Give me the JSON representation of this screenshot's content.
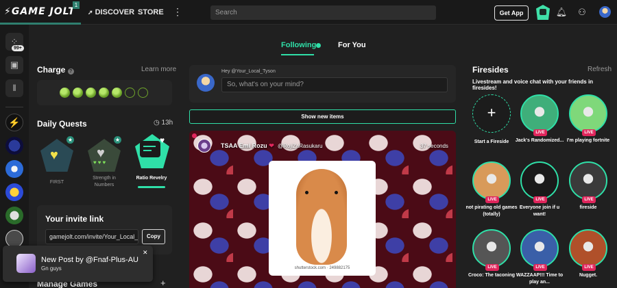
{
  "topbar": {
    "logo": "GAME JOLT",
    "logo_badge": "1",
    "nav_discover": "DISCOVER",
    "nav_store": "STORE",
    "more": "⋮",
    "search_placeholder": "Search",
    "get_app": "Get App"
  },
  "rail": {
    "badge": "99+"
  },
  "charge": {
    "title": "Charge",
    "learn_more": "Learn more",
    "orbs_total": 7,
    "orbs_filled": 5
  },
  "daily_quests": {
    "title": "Daily Quests",
    "timer": "13h",
    "quests": [
      {
        "label": "FIRST"
      },
      {
        "label": "Strength in Numbers"
      },
      {
        "label": "Ratio Revelry"
      }
    ]
  },
  "invite": {
    "title": "Your invite link",
    "link": "gamejolt.com/invite/Your_Local_Tyson",
    "copy": "Copy"
  },
  "toast": {
    "title": "New Post by @Fnaf-Plus-AU",
    "body": "Gn guys",
    "close": "✕"
  },
  "manage_games": {
    "title": "Manage Games",
    "add": "+"
  },
  "feed": {
    "tab_following": "Following",
    "tab_for_you": "For You",
    "compose_greeting": "Hey @Your_Local_Tyson",
    "compose_placeholder": "So, what's on your mind?",
    "show_new": "Show new items",
    "post": {
      "author": "TSAA Emi Rozu",
      "heart": "❤",
      "handle": "@RojiZaRasukaru",
      "time": "37 seconds",
      "image_credit": "shutterstock.com · 249882175"
    }
  },
  "firesides": {
    "title": "Firesides",
    "refresh": "Refresh",
    "subtitle": "Livestream and voice chat with your friends in firesides!",
    "start_label": "Start a Fireside",
    "live_tag": "LIVE",
    "items": [
      {
        "label": "Jack's Randomized...",
        "color": "#3fae7a"
      },
      {
        "label": "I'm playing fortnite",
        "color": "#7fd87a"
      },
      {
        "label": "not pirating old games (totally)",
        "color": "#d89a5a"
      },
      {
        "label": "Everyone join if u want!",
        "color": "#1a1a1a"
      },
      {
        "label": "fireside",
        "color": "#3a3a3a"
      },
      {
        "label": "Croco: The taconing",
        "color": "#555555"
      },
      {
        "label": "WAZZAAP!!! Time to play an...",
        "color": "#3a5fa8"
      },
      {
        "label": "Nugget.",
        "color": "#b0502a"
      }
    ]
  },
  "colors": {
    "accent": "#2fe0a8",
    "live": "#e0265c",
    "charge_green": "#6fa52b"
  }
}
